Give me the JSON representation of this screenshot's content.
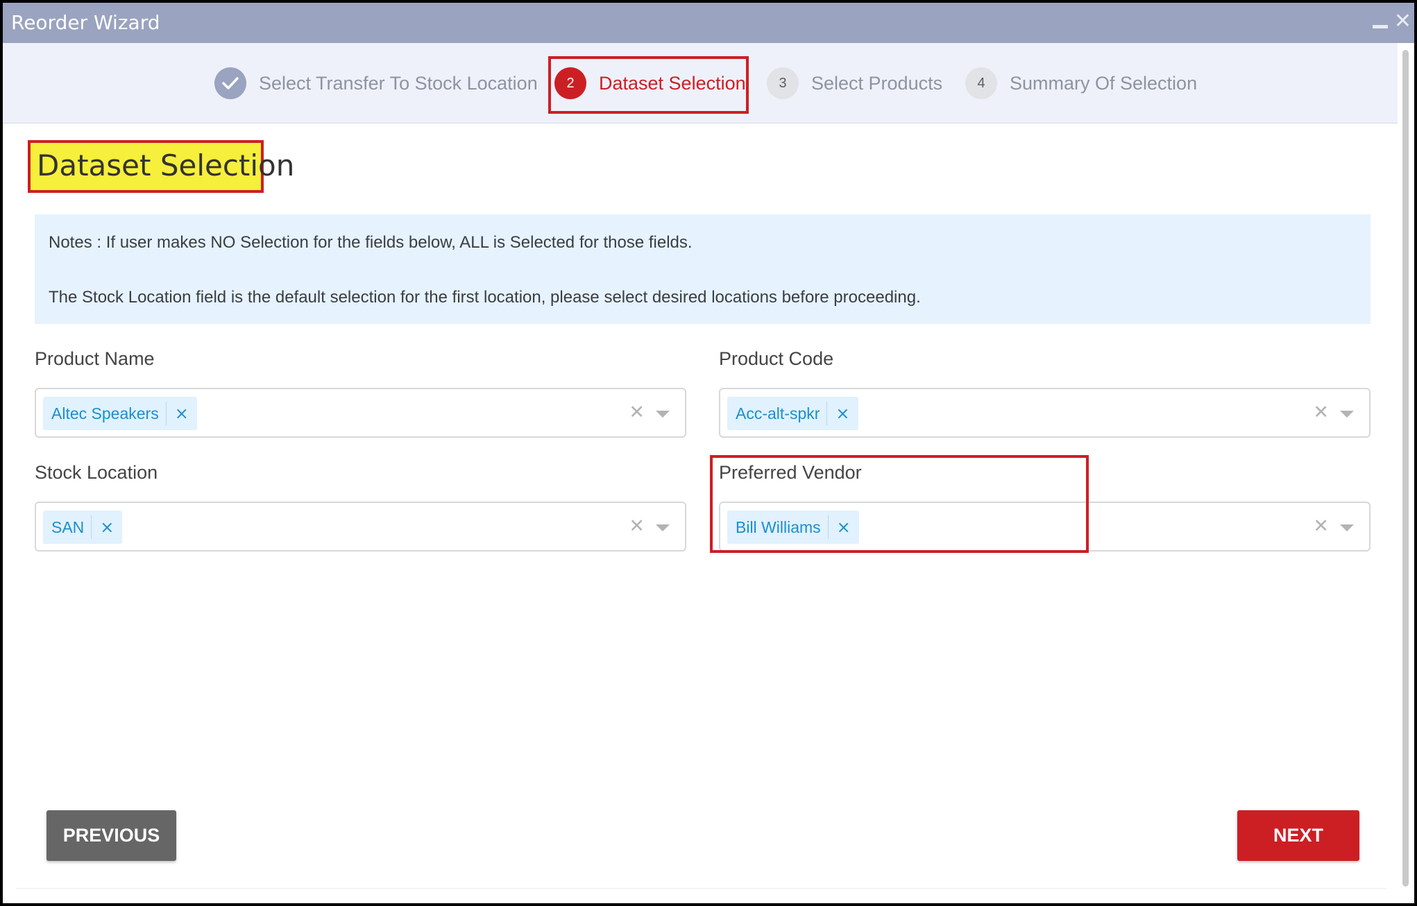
{
  "window": {
    "title": "Reorder Wizard",
    "minimize_icon": "minimize-icon",
    "close_icon": "close-icon",
    "close_glyph": "✕"
  },
  "stepper": {
    "steps": [
      {
        "number": "",
        "label": "Select Transfer To Stock Location",
        "state": "done",
        "icon": "checkmark-icon"
      },
      {
        "number": "2",
        "label": "Dataset Selection",
        "state": "active"
      },
      {
        "number": "3",
        "label": "Select Products",
        "state": "todo"
      },
      {
        "number": "4",
        "label": "Summary Of Selection",
        "state": "todo"
      }
    ]
  },
  "page": {
    "title": "Dataset Selection"
  },
  "notes": {
    "line1": "Notes : If user makes NO Selection for the fields below, ALL is Selected for those fields.",
    "line2": "The Stock Location field is the default selection for the first location, please select desired locations before proceeding."
  },
  "fields": {
    "product_name": {
      "label": "Product Name",
      "chip": "Altec Speakers"
    },
    "product_code": {
      "label": "Product Code",
      "chip": "Acc-alt-spkr"
    },
    "stock_location": {
      "label": "Stock Location",
      "chip": "SAN"
    },
    "preferred_vendor": {
      "label": "Preferred Vendor",
      "chip": "Bill Williams"
    }
  },
  "glyphs": {
    "chip_remove": "×",
    "clear": "✕"
  },
  "buttons": {
    "previous": "PREVIOUS",
    "next": "NEXT"
  },
  "colors": {
    "accent": "#cc1f24",
    "titlebar": "#9aa3bf",
    "chip_text": "#1a8fd0",
    "highlight": "#f6ef3b"
  }
}
